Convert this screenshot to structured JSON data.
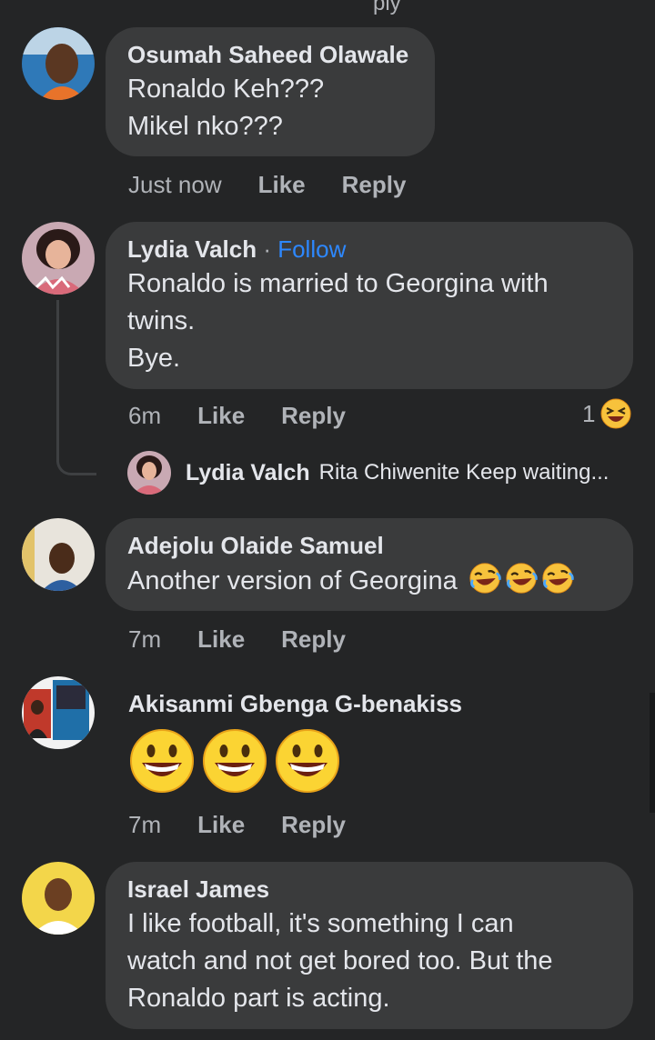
{
  "top_fragment": "ply",
  "comments": [
    {
      "author": "Osumah Saheed Olawale",
      "lines": [
        "Ronaldo Keh???",
        "Mikel nko???"
      ],
      "time": "Just now",
      "like": "Like",
      "reply": "Reply"
    },
    {
      "author": "Lydia Valch",
      "follow_sep": " · ",
      "follow": "Follow",
      "lines": [
        "Ronaldo is married to Georgina with",
        "twins.",
        "Bye."
      ],
      "time": "6m",
      "like": "Like",
      "reply": "Reply",
      "reaction_count": "1",
      "reaction_icon": "laughing-face-icon",
      "reply_preview": {
        "author": "Lydia Valch",
        "text": "Rita Chiwenite Keep waiting..."
      }
    },
    {
      "author": "Adejolu Olaide Samuel",
      "lines": [
        "Another version of Georgina"
      ],
      "emoji_icons": [
        "rolling-laughing-icon",
        "rolling-laughing-icon",
        "rolling-laughing-icon"
      ],
      "time": "7m",
      "like": "Like",
      "reply": "Reply"
    },
    {
      "author": "Akisanmi Gbenga G-benakiss",
      "emoji_icons": [
        "grinning-face-icon",
        "grinning-face-icon",
        "grinning-face-icon"
      ],
      "time": "7m",
      "like": "Like",
      "reply": "Reply"
    },
    {
      "author": "Israel James",
      "lines": [
        "I like football, it's something I can",
        "watch and not get bored too. But the",
        "Ronaldo part is acting."
      ]
    }
  ],
  "colors": {
    "background": "#242526",
    "bubble": "#3a3b3c",
    "link": "#2d88ff",
    "secondary_text": "#b0b3b8"
  }
}
